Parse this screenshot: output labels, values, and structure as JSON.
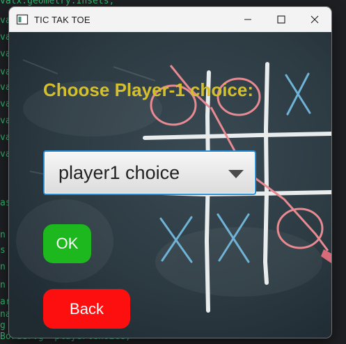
{
  "background_editor": {
    "lines": [
      "vatx.geometry.Insets;",
      "va",
      "va",
      "va",
      "va",
      "va",
      "va",
      "va",
      "va",
      "va",
      "as",
      "n",
      "s",
      "n",
      "n",
      "ar",
      "na",
      "g",
      "Border.g  playerlChoice;"
    ]
  },
  "window": {
    "title": "TIC TAK TOE",
    "controls": {
      "minimize": "minimize-icon",
      "maximize": "maximize-icon",
      "close": "close-icon"
    }
  },
  "main": {
    "heading": "Choose Player-1 choice:",
    "choice_combo": {
      "selected": "player1 choice",
      "icon": "chevron-down-icon"
    },
    "ok_button": "OK",
    "back_button": "Back"
  },
  "colors": {
    "heading": "#d4bf2c",
    "ok": "#1db81d",
    "back": "#fe0f0f",
    "chalk_red": "#e98a93",
    "chalk_blue": "#6fb3d6"
  }
}
